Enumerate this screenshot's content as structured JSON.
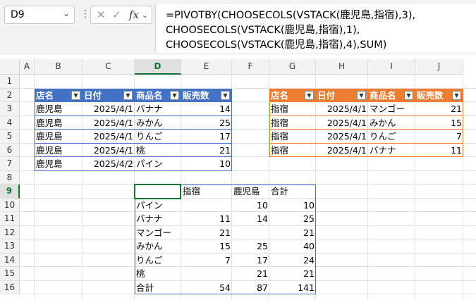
{
  "namebox": {
    "value": "D9"
  },
  "fx_label": "fx",
  "formula": {
    "lines": [
      "=PIVOTBY(CHOOSECOLS(VSTACK(鹿児島,指宿),3),",
      "CHOOSECOLS(VSTACK(鹿児島,指宿),1),",
      "CHOOSECOLS(VSTACK(鹿児島,指宿),4),SUM)"
    ]
  },
  "columns": [
    "A",
    "B",
    "C",
    "D",
    "E",
    "F",
    "G",
    "H",
    "I",
    "J"
  ],
  "rows": [
    "1",
    "2",
    "3",
    "4",
    "5",
    "6",
    "7",
    "8",
    "9",
    "10",
    "11",
    "12",
    "13",
    "14",
    "15",
    "16"
  ],
  "selected": {
    "column": "D",
    "row": "9"
  },
  "colors": {
    "blue": "#4472c4",
    "orange": "#ed7d31",
    "select": "#137333"
  },
  "table_kagoshima": {
    "headers": [
      "店名",
      "日付",
      "商品名",
      "販売数"
    ],
    "rows": [
      [
        "鹿児島",
        "2025/4/1",
        "バナナ",
        "14"
      ],
      [
        "鹿児島",
        "2025/4/1",
        "みかん",
        "25"
      ],
      [
        "鹿児島",
        "2025/4/1",
        "りんご",
        "17"
      ],
      [
        "鹿児島",
        "2025/4/1",
        "桃",
        "21"
      ],
      [
        "鹿児島",
        "2025/4/2",
        "パイン",
        "10"
      ]
    ]
  },
  "table_ibusuki": {
    "headers": [
      "店名",
      "日付",
      "商品名",
      "販売数"
    ],
    "rows": [
      [
        "指宿",
        "2025/4/1",
        "マンゴー",
        "21"
      ],
      [
        "指宿",
        "2025/4/1",
        "みかん",
        "15"
      ],
      [
        "指宿",
        "2025/4/1",
        "りんご",
        "7"
      ],
      [
        "指宿",
        "2025/4/1",
        "バナナ",
        "11"
      ]
    ]
  },
  "pivot": {
    "headers": [
      "",
      "指宿",
      "鹿児島",
      "合計"
    ],
    "rows": [
      [
        "パイン",
        "",
        "10",
        "10"
      ],
      [
        "バナナ",
        "11",
        "14",
        "25"
      ],
      [
        "マンゴー",
        "21",
        "",
        "21"
      ],
      [
        "みかん",
        "15",
        "25",
        "40"
      ],
      [
        "りんご",
        "7",
        "17",
        "24"
      ],
      [
        "桃",
        "",
        "21",
        "21"
      ],
      [
        "合計",
        "54",
        "87",
        "141"
      ]
    ]
  }
}
